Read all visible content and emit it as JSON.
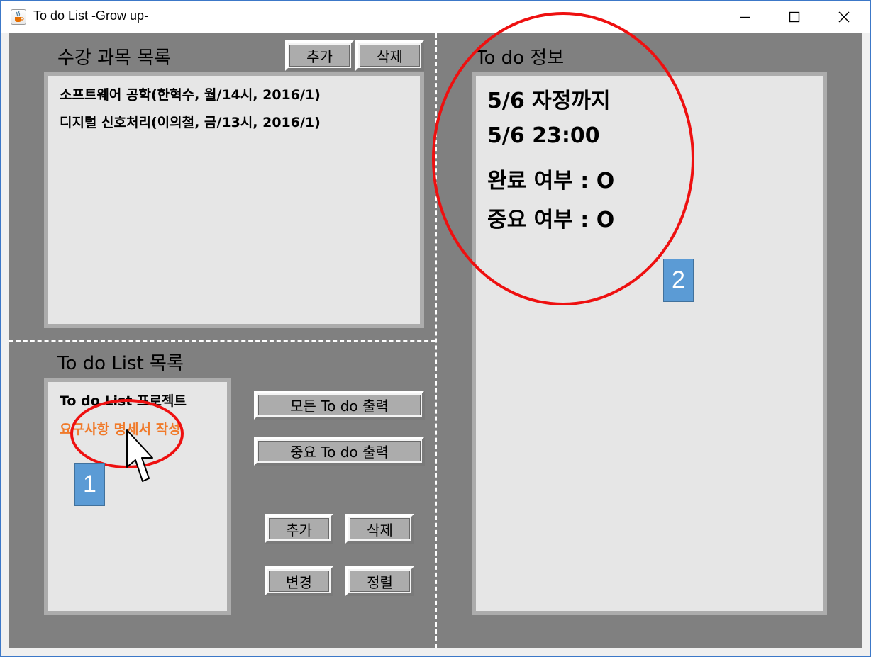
{
  "window": {
    "title": "To do List -Grow up-"
  },
  "courses": {
    "title": "수강 과목 목록",
    "add_label": "추가",
    "delete_label": "삭제",
    "items": [
      "소프트웨어 공학(한혁수, 월/14시, 2016/1)",
      "디지털 신호처리(이의철, 금/13시, 2016/1)"
    ]
  },
  "todo_list": {
    "title": "To do List 목록",
    "items": [
      "To do List 프로젝트",
      "요구사항 명세서 작성"
    ],
    "selected_index": 1,
    "show_all_label": "모든 To do 출력",
    "show_important_label": "중요 To do 출력",
    "add_label": "추가",
    "delete_label": "삭제",
    "change_label": "변경",
    "sort_label": "정렬"
  },
  "todo_info": {
    "title": "To do 정보",
    "lines": [
      "5/6 자정까지",
      "5/6 23:00",
      "완료 여부 : O",
      "중요 여부 : O"
    ]
  },
  "annotations": {
    "badge1": "1",
    "badge2": "2"
  },
  "colors": {
    "selected_item": "#f07a2a",
    "annotation_circle": "#ee1010",
    "badge": "#5b9bd5",
    "client_background": "#808080",
    "panel_background": "#e6e6e6"
  }
}
